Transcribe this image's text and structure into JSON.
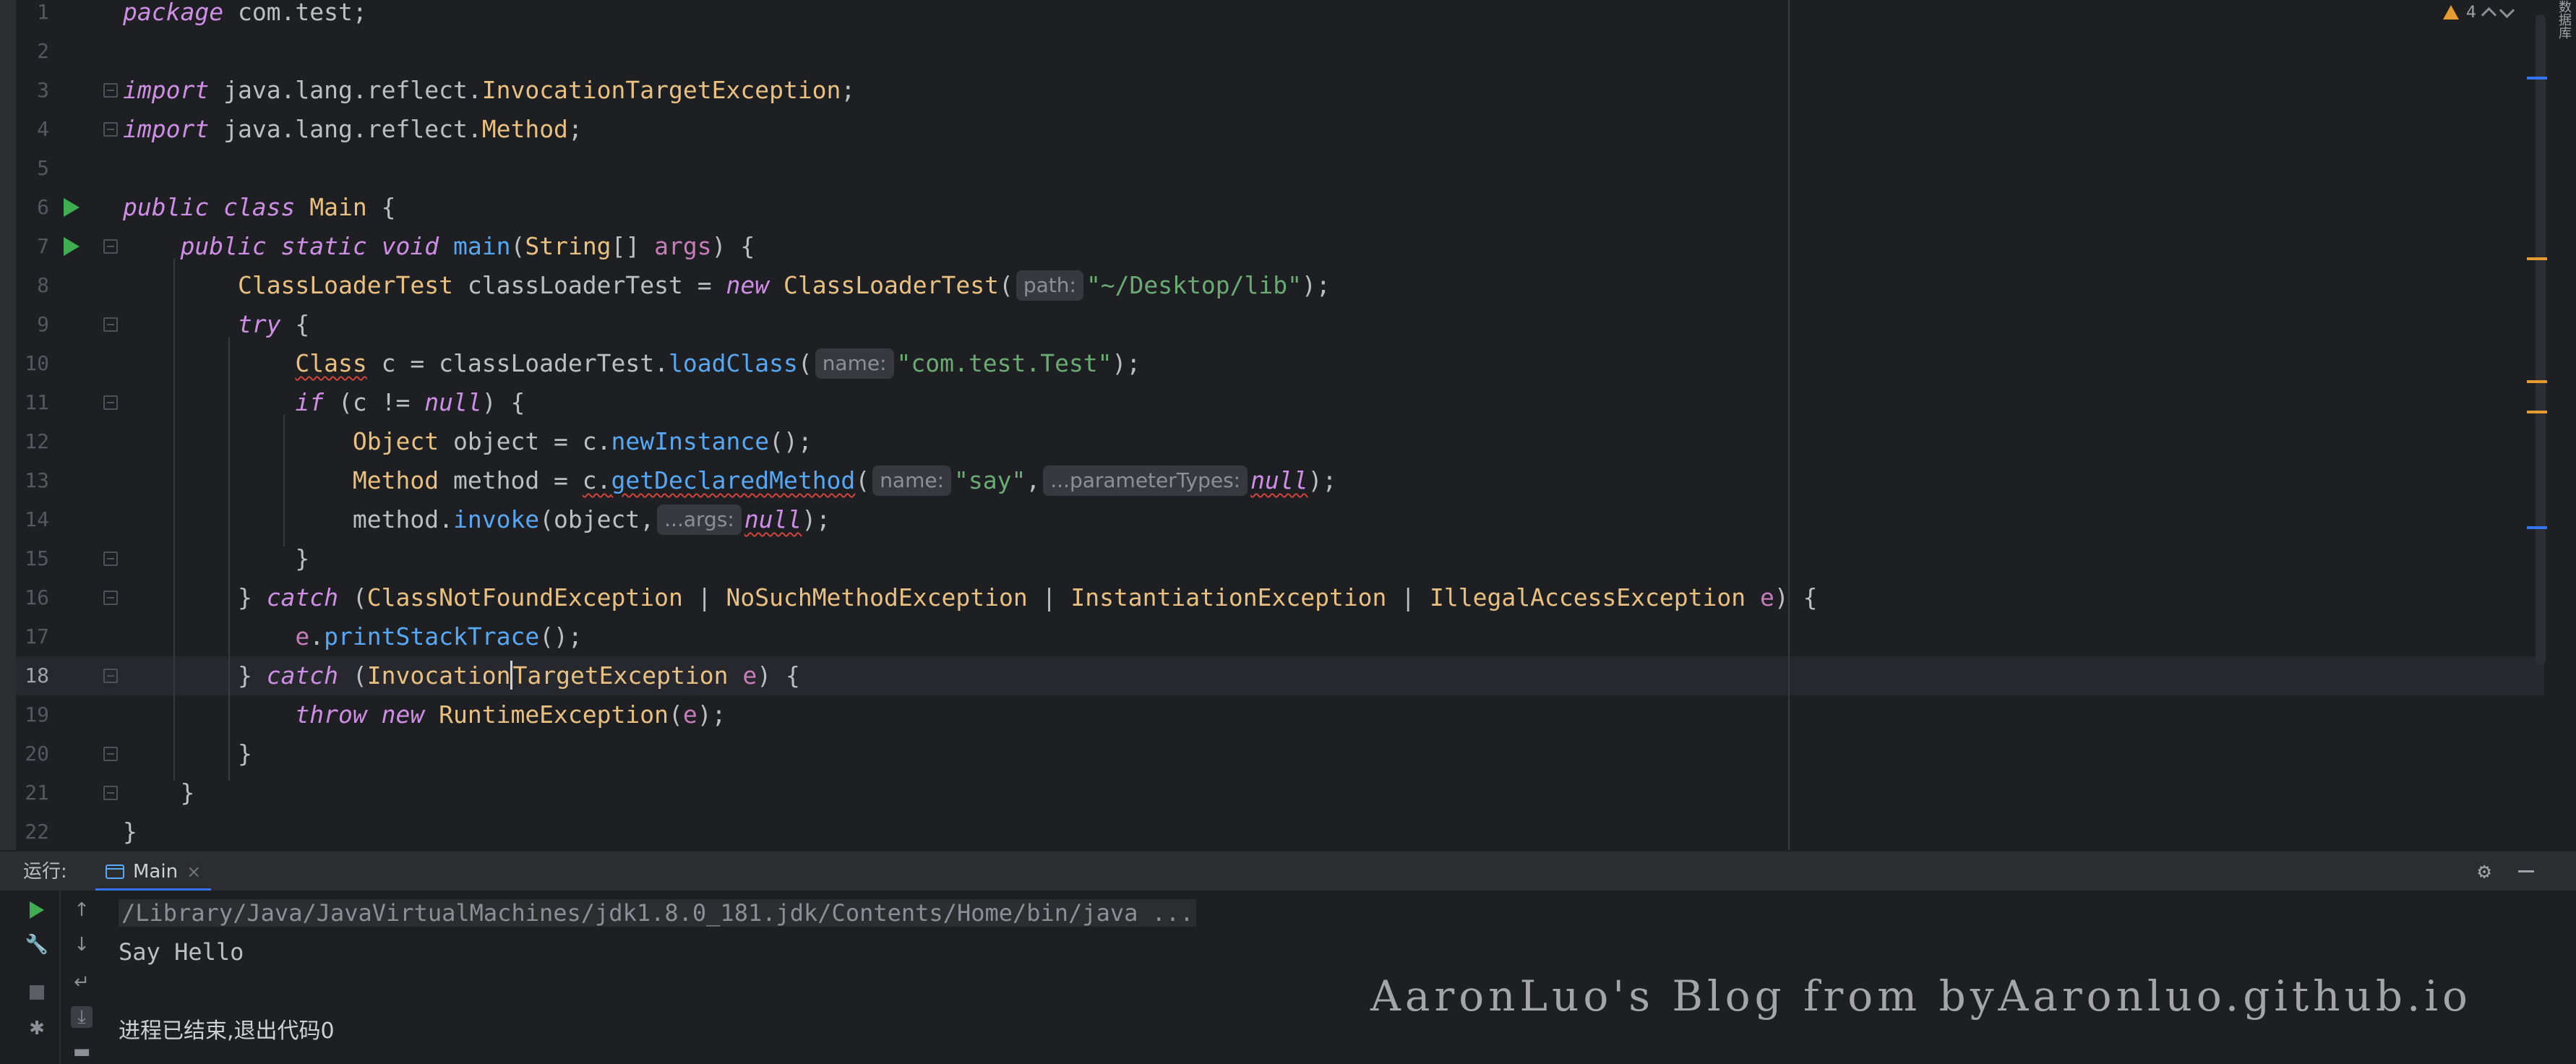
{
  "editor": {
    "problems_count": "4",
    "side_label": "数据库",
    "lines": [
      {
        "no": "1",
        "tokens": [
          [
            "kw",
            "package"
          ],
          [
            "plain",
            " com.test;"
          ]
        ]
      },
      {
        "no": "2",
        "tokens": []
      },
      {
        "no": "3",
        "tokens": [
          [
            "kw",
            "import"
          ],
          [
            "plain",
            " java.lang.reflect."
          ],
          [
            "cls",
            "InvocationTargetException"
          ],
          [
            "plain",
            ";"
          ]
        ]
      },
      {
        "no": "4",
        "tokens": [
          [
            "kw",
            "import"
          ],
          [
            "plain",
            " java.lang.reflect."
          ],
          [
            "cls",
            "Method"
          ],
          [
            "plain",
            ";"
          ]
        ]
      },
      {
        "no": "5",
        "tokens": []
      },
      {
        "no": "6",
        "tokens": [
          [
            "kw",
            "public class"
          ],
          [
            "plain",
            " "
          ],
          [
            "cls",
            "Main"
          ],
          [
            "plain",
            " {"
          ]
        ]
      },
      {
        "no": "7",
        "tokens": [
          [
            "plain",
            "    "
          ],
          [
            "kw",
            "public static void"
          ],
          [
            "plain",
            " "
          ],
          [
            "fn",
            "main"
          ],
          [
            "plain",
            "("
          ],
          [
            "cls",
            "String"
          ],
          [
            "plain",
            "[] "
          ],
          [
            "par",
            "args"
          ],
          [
            "plain",
            ") {"
          ]
        ]
      },
      {
        "no": "8",
        "tokens": [
          [
            "plain",
            "        "
          ],
          [
            "cls",
            "ClassLoaderTest"
          ],
          [
            "plain",
            " classLoaderTest = "
          ],
          [
            "kw",
            "new"
          ],
          [
            "plain",
            " "
          ],
          [
            "cls",
            "ClassLoaderTest"
          ],
          [
            "plain",
            "("
          ],
          [
            "hint",
            "path:"
          ],
          [
            "str",
            "\"~/Desktop/lib\""
          ],
          [
            "plain",
            ");"
          ]
        ]
      },
      {
        "no": "9",
        "tokens": [
          [
            "plain",
            "        "
          ],
          [
            "kw",
            "try"
          ],
          [
            "plain",
            " {"
          ]
        ]
      },
      {
        "no": "10",
        "tokens": [
          [
            "plain",
            "            "
          ],
          [
            "cls-ul",
            "Class"
          ],
          [
            "plain",
            " c = classLoaderTest."
          ],
          [
            "fn",
            "loadClass"
          ],
          [
            "plain",
            "("
          ],
          [
            "hint",
            "name:"
          ],
          [
            "str",
            "\"com.test.Test\""
          ],
          [
            "plain",
            ");"
          ]
        ]
      },
      {
        "no": "11",
        "tokens": [
          [
            "plain",
            "            "
          ],
          [
            "kw",
            "if"
          ],
          [
            "plain",
            " (c != "
          ],
          [
            "kw",
            "null"
          ],
          [
            "plain",
            ") {"
          ]
        ]
      },
      {
        "no": "12",
        "tokens": [
          [
            "plain",
            "                "
          ],
          [
            "cls",
            "Object"
          ],
          [
            "plain",
            " object = c."
          ],
          [
            "fn",
            "newInstance"
          ],
          [
            "plain",
            "();"
          ]
        ]
      },
      {
        "no": "13",
        "tokens": [
          [
            "plain",
            "                "
          ],
          [
            "cls",
            "Method"
          ],
          [
            "plain",
            " method = "
          ],
          [
            "plain-ul",
            "c."
          ],
          [
            "fn-ul",
            "getDeclaredMethod"
          ],
          [
            "plain",
            "("
          ],
          [
            "hint",
            "name:"
          ],
          [
            "str",
            "\"say\""
          ],
          [
            "plain",
            ","
          ],
          [
            "hint",
            "...parameterTypes:"
          ],
          [
            "kw-ul",
            "null"
          ],
          [
            "plain",
            ");"
          ]
        ]
      },
      {
        "no": "14",
        "tokens": [
          [
            "plain",
            "                method."
          ],
          [
            "fn",
            "invoke"
          ],
          [
            "plain",
            "(object,"
          ],
          [
            "hint",
            "...args:"
          ],
          [
            "kw-ul",
            "null"
          ],
          [
            "plain",
            ");"
          ]
        ]
      },
      {
        "no": "15",
        "tokens": [
          [
            "plain",
            "            }"
          ]
        ]
      },
      {
        "no": "16",
        "tokens": [
          [
            "plain",
            "        } "
          ],
          [
            "kw",
            "catch"
          ],
          [
            "plain",
            " ("
          ],
          [
            "cls",
            "ClassNotFoundException"
          ],
          [
            "plain",
            " | "
          ],
          [
            "cls",
            "NoSuchMethodException"
          ],
          [
            "plain",
            " | "
          ],
          [
            "cls",
            "InstantiationException"
          ],
          [
            "plain",
            " | "
          ],
          [
            "cls",
            "IllegalAccessException"
          ],
          [
            "plain",
            " "
          ],
          [
            "par",
            "e"
          ],
          [
            "plain",
            ") {"
          ]
        ]
      },
      {
        "no": "17",
        "tokens": [
          [
            "plain",
            "            "
          ],
          [
            "par",
            "e"
          ],
          [
            "plain",
            "."
          ],
          [
            "fn",
            "printStackTrace"
          ],
          [
            "plain",
            "();"
          ]
        ]
      },
      {
        "no": "18",
        "tokens": [
          [
            "plain",
            "        } "
          ],
          [
            "kw",
            "catch"
          ],
          [
            "plain",
            " ("
          ],
          [
            "cls",
            "Invocation"
          ],
          [
            "caret",
            ""
          ],
          [
            "cls",
            "TargetException"
          ],
          [
            "plain",
            " "
          ],
          [
            "par",
            "e"
          ],
          [
            "plain",
            ") {"
          ]
        ]
      },
      {
        "no": "19",
        "tokens": [
          [
            "plain",
            "            "
          ],
          [
            "kw",
            "throw new"
          ],
          [
            "plain",
            " "
          ],
          [
            "cls",
            "RuntimeException"
          ],
          [
            "plain",
            "("
          ],
          [
            "par",
            "e"
          ],
          [
            "plain",
            ");"
          ]
        ]
      },
      {
        "no": "20",
        "tokens": [
          [
            "plain",
            "        }"
          ]
        ]
      },
      {
        "no": "21",
        "tokens": [
          [
            "plain",
            "    }"
          ]
        ]
      },
      {
        "no": "22",
        "tokens": [
          [
            "plain",
            "}"
          ]
        ]
      }
    ]
  },
  "run_panel": {
    "label": "运行:",
    "tab_label": "Main",
    "tab_close": "×",
    "output": {
      "command": "/Library/Java/JavaVirtualMachines/jdk1.8.0_181.jdk/Contents/Home/bin/java ...",
      "line1": "Say Hello",
      "exit": "进程已结束,退出代码0"
    }
  },
  "watermark": "AaronLuo's Blog from byAaronluo.github.io",
  "colors": {
    "keyword": "#cf8ee6",
    "class": "#e9c080",
    "function": "#56a8f5",
    "string": "#6aab73",
    "parameter": "#c77dbb",
    "run_green": "#3fae52",
    "warning": "#e49c31",
    "accent": "#3574f0"
  }
}
